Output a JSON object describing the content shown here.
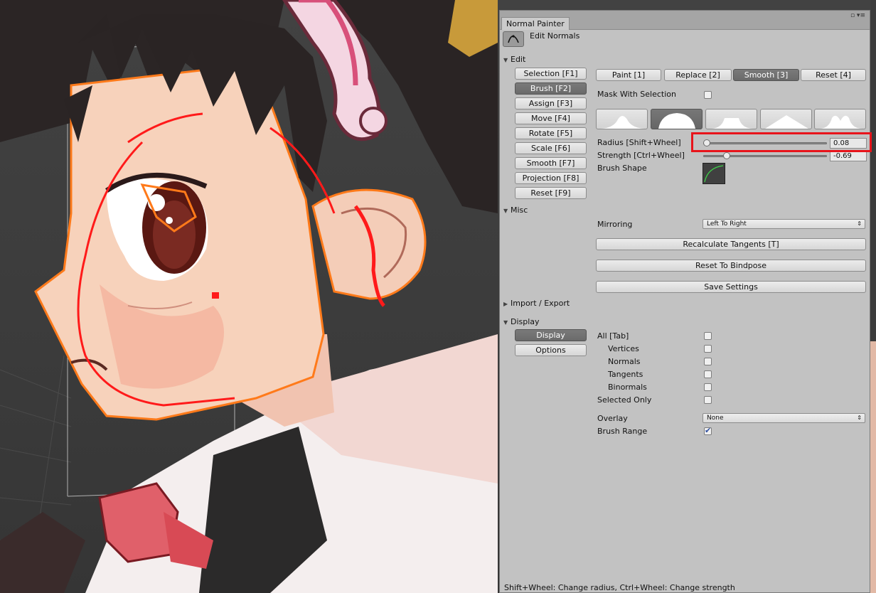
{
  "window": {
    "title": "Normal Painter",
    "icons": "▫ ▾≡",
    "tool_label": "Edit Normals",
    "tool_icon": "brush-curve-icon"
  },
  "edit": {
    "section": "Edit",
    "modes": [
      "Selection [F1]",
      "Brush [F2]",
      "Assign [F3]",
      "Move [F4]",
      "Rotate [F5]",
      "Scale [F6]",
      "Smooth [F7]",
      "Projection [F8]",
      "Reset [F9]"
    ],
    "active_mode": "Brush [F2]",
    "brush_modes": [
      "Paint [1]",
      "Replace [2]",
      "Smooth [3]",
      "Reset [4]"
    ],
    "active_brush_mode": "Smooth [3]",
    "mask_with_selection_label": "Mask With Selection",
    "mask_with_selection": false,
    "brush_shapes_count": 5,
    "active_brush_shape": 2,
    "radius_label": "Radius [Shift+Wheel]",
    "radius_value": "0.08",
    "radius_fraction": 0.0,
    "strength_label": "Strength [Ctrl+Wheel]",
    "strength_value": "-0.69",
    "strength_fraction": 0.17,
    "brush_shape_label": "Brush Shape"
  },
  "misc": {
    "section": "Misc",
    "mirroring_label": "Mirroring",
    "mirroring_value": "Left To Right",
    "recalculate_tangents": "Recalculate Tangents [T]",
    "reset_to_bindpose": "Reset To Bindpose",
    "save_settings": "Save Settings"
  },
  "import_export": {
    "section": "Import / Export"
  },
  "display": {
    "section": "Display",
    "tabs": [
      "Display",
      "Options"
    ],
    "active_tab": "Display",
    "all_label": "All [Tab]",
    "vertices_label": "Vertices",
    "normals_label": "Normals",
    "tangents_label": "Tangents",
    "binormals_label": "Binormals",
    "selected_only_label": "Selected Only",
    "overlay_label": "Overlay",
    "overlay_value": "None",
    "brush_range_label": "Brush Range",
    "checks": {
      "all": false,
      "vertices": false,
      "normals": false,
      "tangents": false,
      "binormals": false,
      "selected_only": false,
      "brush_range": true
    }
  },
  "status": "Shift+Wheel: Change radius, Ctrl+Wheel: Change strength",
  "colors": {
    "highlight": "#e8141b",
    "panel_bg": "#c2c2c2",
    "active_button": "#6f6f6f",
    "selection_outline": "#ff7a1a",
    "brush_stroke": "#ff1a1a"
  }
}
